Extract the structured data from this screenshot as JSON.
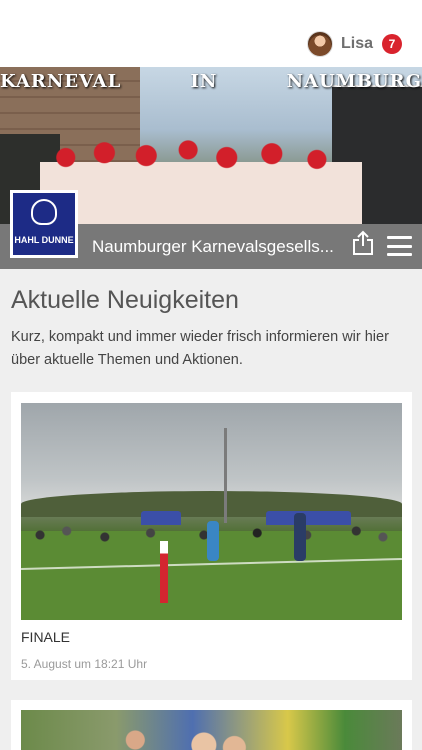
{
  "header": {
    "user_name": "Lisa",
    "notification_count": "7"
  },
  "hero": {
    "caption": "KARNEVAL IN NAUMBURG"
  },
  "club": {
    "name": "Naumburger Karnevalsgesells...",
    "logo_text": "HAHL DUNNE"
  },
  "section": {
    "title": "Aktuelle Neuigkeiten",
    "description": "Kurz, kompakt und immer wieder frisch informieren wir hier über aktuelle Themen und Aktionen."
  },
  "news": [
    {
      "title": "FINALE",
      "date": "5. August um 18:21 Uhr"
    }
  ],
  "colors": {
    "badge": "#d9232d",
    "club_bar": "#6e6e6e",
    "logo_blue": "#1d2b86"
  },
  "icons": {
    "share": "share-icon",
    "menu": "hamburger-menu-icon"
  }
}
